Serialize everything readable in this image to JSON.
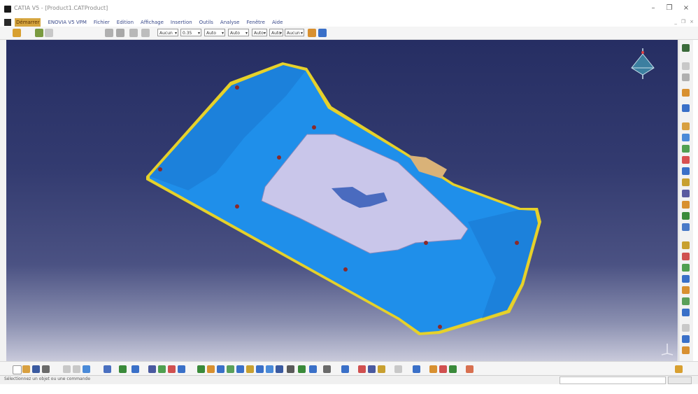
{
  "window": {
    "title": "CATIA V5 - [Product1.CATProduct]",
    "minimize_label": "–",
    "maximize_label": "❐",
    "close_label": "×"
  },
  "menu": {
    "items": [
      "Démarrer",
      "ENOVIA V5 VPM",
      "Fichier",
      "Edition",
      "Affichage",
      "Insertion",
      "Outils",
      "Analyse",
      "Fenêtre",
      "Aide"
    ]
  },
  "toolbar": {
    "selects": [
      "Aucun",
      "0.35",
      "Auto",
      "Auto",
      "Auto",
      "Auto",
      "Aucun"
    ]
  },
  "status": {
    "message": "Sélectionnez un objet ou une commande"
  },
  "colors": {
    "viewport_top": "#262e63",
    "viewport_bottom": "#c9cadb",
    "part_blue": "#1f8fea",
    "part_edge": "#e6d12a",
    "inner_panel": "#c9c6ea",
    "accent_tab": "#d9b278"
  },
  "icons": {
    "compass": "compass-icon",
    "axis": "axis-icon",
    "app": "catia-icon"
  }
}
